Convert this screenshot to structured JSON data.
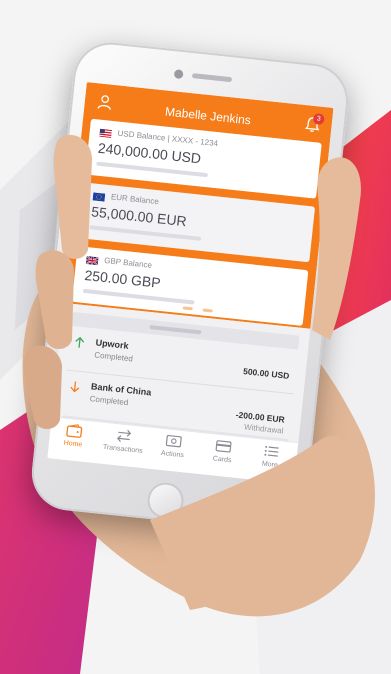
{
  "colors": {
    "accent": "#f57c18",
    "background": "#f4f4f4",
    "red_shape": "#e8344b",
    "pink_shape": "#d8387a",
    "skin": "#e2b797",
    "positive": "#3ca55c",
    "negative": "#f57c18",
    "badge": "#e53935"
  },
  "header": {
    "user_name": "Mabelle Jenkins",
    "notification_count": "3",
    "user_icon": "user-icon",
    "bell_icon": "bell-icon"
  },
  "cards": [
    {
      "flag": "us-flag-icon",
      "label": "USD Balance | XXXX - 1234",
      "amount": "240,000.00 USD"
    },
    {
      "flag": "eu-flag-icon",
      "label": "EUR Balance",
      "amount": "55,000.00 EUR"
    },
    {
      "flag": "gb-flag-icon",
      "label": "GBP Balance",
      "amount": "250.00 GBP"
    }
  ],
  "pager": {
    "count": 3,
    "active": 0
  },
  "transactions": [
    {
      "name": "Upwork",
      "status": "Completed",
      "amount": "500.00 USD",
      "type": "",
      "direction": "in"
    },
    {
      "name": "Bank of China",
      "status": "Completed",
      "amount": "-200.00 EUR",
      "type": "Withdrawal",
      "direction": "out"
    }
  ],
  "tabs": [
    {
      "label": "Home",
      "icon": "wallet-icon",
      "active": true
    },
    {
      "label": "Transactions",
      "icon": "transfer-icon",
      "active": false
    },
    {
      "label": "Actions",
      "icon": "cash-icon",
      "active": false
    },
    {
      "label": "Cards",
      "icon": "card-icon",
      "active": false
    },
    {
      "label": "More",
      "icon": "list-icon",
      "active": false
    }
  ]
}
